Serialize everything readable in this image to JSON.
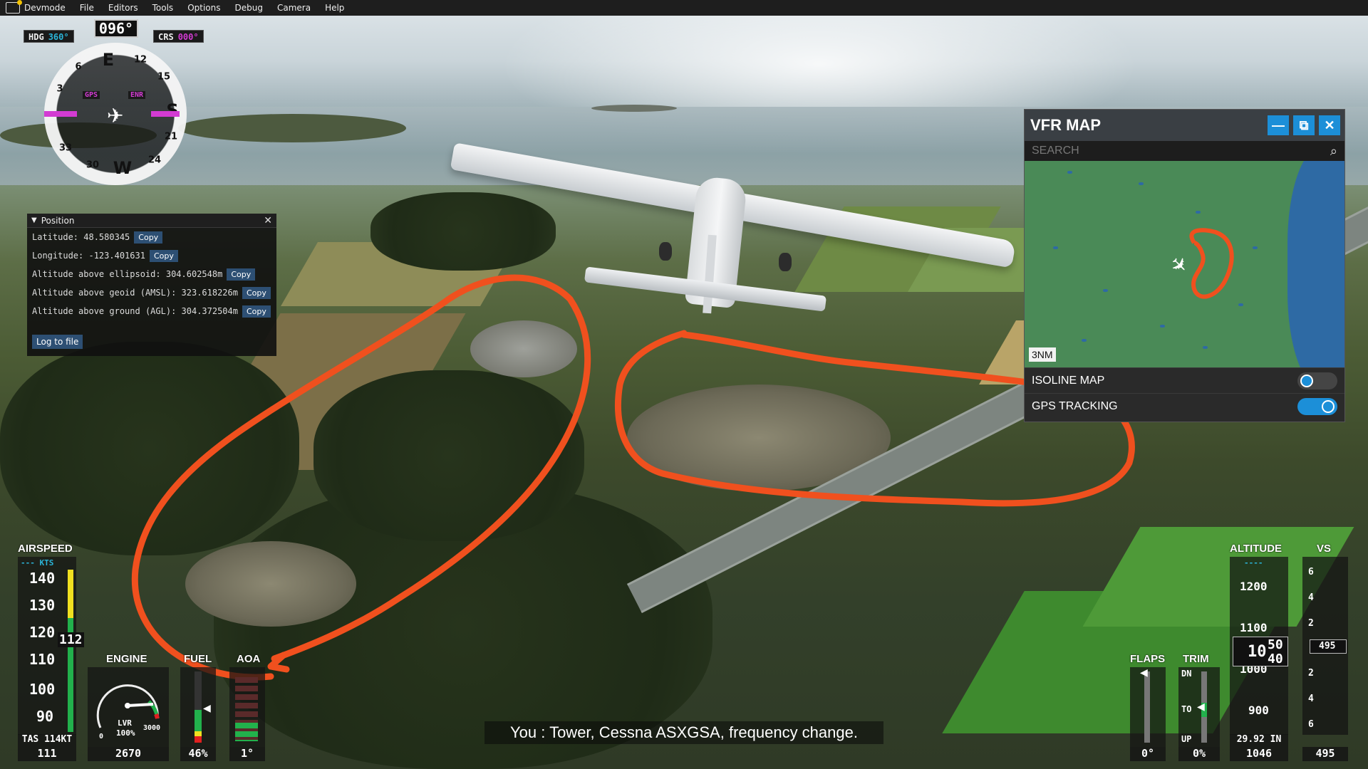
{
  "menu": {
    "items": [
      "Devmode",
      "File",
      "Editors",
      "Tools",
      "Options",
      "Debug",
      "Camera",
      "Help"
    ]
  },
  "compass": {
    "heading_readout": "096°",
    "hdg_label": "HDG",
    "hdg_value": "360°",
    "crs_label": "CRS",
    "crs_value": "000°",
    "gps_tag": "GPS",
    "enr_tag": "ENR",
    "card_labels": [
      "E",
      "12",
      "15",
      "S",
      "21",
      "24",
      "W",
      "30",
      "33",
      "3",
      "6"
    ]
  },
  "position_panel": {
    "title": "Position",
    "copy_label": "Copy",
    "rows": [
      "Latitude: 48.580345",
      "Longitude: -123.401631",
      "Altitude above ellipsoid: 304.602548m",
      "Altitude above geoid (AMSL): 323.618226m",
      "Altitude above ground (AGL): 304.372504m"
    ],
    "log_button": "Log to file"
  },
  "vfr_map": {
    "title": "VFR MAP",
    "search_placeholder": "SEARCH",
    "scale": "3NM",
    "isoline_label": "ISOLINE MAP",
    "isoline_on": false,
    "gps_label": "GPS TRACKING",
    "gps_on": true,
    "water_color": "#2e6aa4",
    "land_color": "#4a8a57"
  },
  "airspeed": {
    "title": "AIRSPEED",
    "unit": "--- KTS",
    "ticks": [
      "140",
      "130",
      "120",
      "110",
      "100",
      "90"
    ],
    "current": "112",
    "tas": "TAS 114KT",
    "value": "111"
  },
  "engine": {
    "title": "ENGINE",
    "lever_label": "LVR",
    "lever_pct": "100%",
    "scale_min": "0",
    "scale_max": "3000",
    "rpm": "2670"
  },
  "fuel": {
    "title": "FUEL",
    "value": "46%",
    "level": 0.46
  },
  "aoa": {
    "title": "AOA",
    "value": "1°"
  },
  "flaps": {
    "title": "FLAPS",
    "value": "0°"
  },
  "trim": {
    "title": "TRIM",
    "dn": "DN",
    "to": "TO",
    "up": "UP",
    "value": "0%"
  },
  "altitude": {
    "title": "ALTITUDE",
    "dashes": "----",
    "ticks": [
      "1200",
      "1100",
      "1000",
      "900"
    ],
    "current_big": "10",
    "current_small_top": "50",
    "current_small_bottom": "40",
    "baro": "29.92 IN",
    "value": "1046"
  },
  "vs": {
    "title": "VS",
    "ticks": [
      "6",
      "4",
      "2",
      "2",
      "4",
      "6"
    ],
    "current": "495",
    "value": "495"
  },
  "subtitle": "You :  Tower, Cessna ASXGSA, frequency change."
}
